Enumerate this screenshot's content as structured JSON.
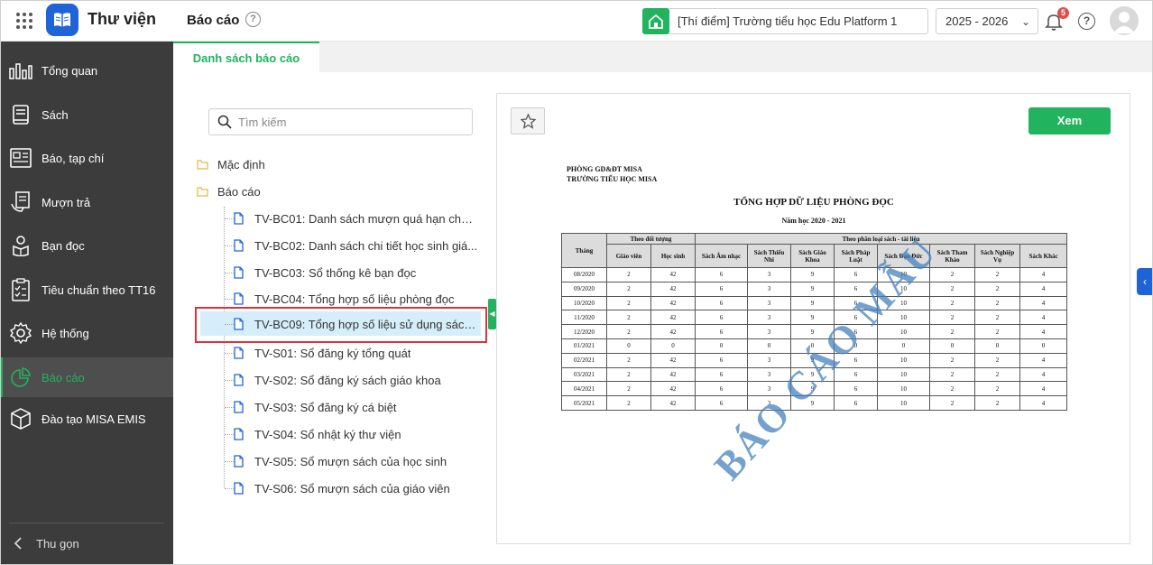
{
  "app": {
    "name": "Thư viện",
    "page_title": "Báo cáo",
    "page_help": "?"
  },
  "header": {
    "school": "[Thí điểm] Trường tiểu học Edu Platform 1",
    "year": "2025 - 2026",
    "notification_count": "5",
    "help": "?"
  },
  "sidebar": {
    "items": [
      {
        "label": "Tổng quan",
        "icon": "dashboard-icon"
      },
      {
        "label": "Sách",
        "icon": "book-icon"
      },
      {
        "label": "Báo, tạp chí",
        "icon": "newspaper-icon"
      },
      {
        "label": "Mượn trả",
        "icon": "borrow-icon"
      },
      {
        "label": "Bạn đọc",
        "icon": "reader-icon"
      },
      {
        "label": "Tiêu chuẩn theo TT16",
        "icon": "checklist-icon"
      },
      {
        "label": "Hệ thống",
        "icon": "gear-icon"
      },
      {
        "label": "Báo cáo",
        "icon": "pie-chart-icon",
        "active": true
      },
      {
        "label": "Đào tạo MISA EMIS",
        "icon": "cube-icon"
      }
    ],
    "collapse_label": "Thu gọn"
  },
  "tabs": [
    {
      "label": "Danh sách báo cáo",
      "active": true
    }
  ],
  "search": {
    "placeholder": "Tìm kiếm"
  },
  "tree": {
    "folders": [
      "Mặc định",
      "Báo cáo"
    ],
    "reports": [
      "TV-BC01: Danh sách mượn quá hạn chưa...",
      "TV-BC02: Danh sách chi tiết học sinh giá...",
      "TV-BC03: Sổ thống kê bạn đọc",
      "TV-BC04: Tổng hợp số liệu phòng đọc",
      "TV-BC09: Tổng hợp số liệu sử dụng sách...",
      "TV-S01: Sổ đăng ký tổng quát",
      "TV-S02: Sổ đăng ký sách giáo khoa",
      "TV-S03: Sổ đăng ký cá biệt",
      "TV-S04: Sổ nhật ký thư viện",
      "TV-S05: Sổ mượn sách của học sinh",
      "TV-S06: Sổ mượn sách của giáo viên"
    ],
    "selected_index": 4
  },
  "preview": {
    "view_button": "Xem",
    "doc": {
      "org_line1": "PHÒNG GD&ĐT MISA",
      "org_line2": "TRƯỜNG TIỂU HỌC MISA",
      "title": "TỔNG HỢP DỮ LIỆU PHÒNG ĐỌC",
      "subtitle": "Năm học 2020 - 2021",
      "group1": "Theo đối tượng",
      "group2": "Theo phân loại sách - tài liệu",
      "columns": [
        "Tháng",
        "Giáo viên",
        "Học sinh",
        "Sách Âm nhạc",
        "Sách Thiếu Nhi",
        "Sách Giáo Khoa",
        "Sách Pháp Luật",
        "Sách Đạo Đức",
        "Sách Tham Khảo",
        "Sách Nghiệp Vụ",
        "Sách Khác"
      ],
      "rows": [
        [
          "08/2020",
          "2",
          "42",
          "6",
          "3",
          "9",
          "6",
          "10",
          "2",
          "2",
          "4"
        ],
        [
          "09/2020",
          "2",
          "42",
          "6",
          "3",
          "9",
          "6",
          "10",
          "2",
          "2",
          "4"
        ],
        [
          "10/2020",
          "2",
          "42",
          "6",
          "3",
          "9",
          "6",
          "10",
          "2",
          "2",
          "4"
        ],
        [
          "11/2020",
          "2",
          "42",
          "6",
          "3",
          "9",
          "6",
          "10",
          "2",
          "2",
          "4"
        ],
        [
          "12/2020",
          "2",
          "42",
          "6",
          "3",
          "9",
          "6",
          "10",
          "2",
          "2",
          "4"
        ],
        [
          "01/2021",
          "0",
          "0",
          "0",
          "0",
          "0",
          "0",
          "0",
          "0",
          "0",
          "0"
        ],
        [
          "02/2021",
          "2",
          "42",
          "6",
          "3",
          "9",
          "6",
          "10",
          "2",
          "2",
          "4"
        ],
        [
          "03/2021",
          "2",
          "42",
          "6",
          "3",
          "9",
          "6",
          "10",
          "2",
          "2",
          "4"
        ],
        [
          "04/2021",
          "2",
          "42",
          "6",
          "3",
          "9",
          "6",
          "10",
          "2",
          "2",
          "4"
        ],
        [
          "05/2021",
          "2",
          "42",
          "6",
          "3",
          "9",
          "6",
          "10",
          "2",
          "2",
          "4"
        ]
      ],
      "watermark": "BÁO CÁO MẪU"
    }
  },
  "colors": {
    "accent": "#21b35e",
    "brand": "#1f63d8",
    "sidebar_bg": "#3c3c3c",
    "highlight": "#d9343a"
  }
}
